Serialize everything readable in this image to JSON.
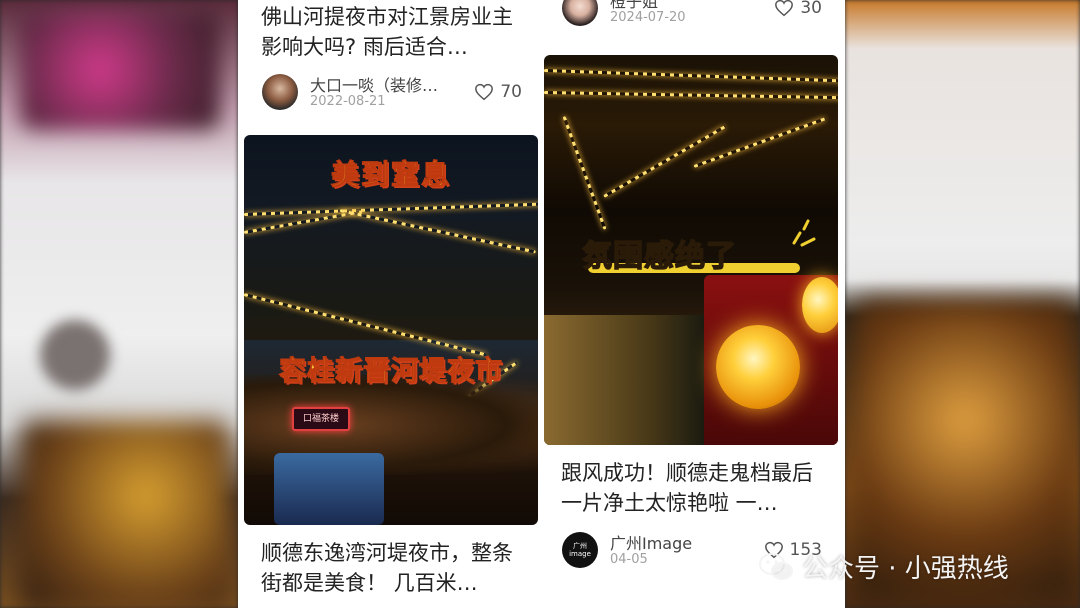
{
  "feed": {
    "left_column": {
      "post_1": {
        "title": "佛山河提夜市对江景房业主影响大吗? 雨后适合…",
        "author": "大口一啖（装修…",
        "date": "2022-08-21",
        "likes": "70"
      },
      "post_2": {
        "image_caption_top": "美到窒息",
        "image_caption_main": "容桂新晋河堤夜市",
        "image_sign": "口福茶楼",
        "title": "顺德东逸湾河堤夜市，整条街都是美食！ 几百米…"
      }
    },
    "right_column": {
      "post_1": {
        "author": "橙子姐",
        "date": "2024-07-20",
        "likes": "30"
      },
      "post_2": {
        "image_caption": "氛围感绝了",
        "title": "跟风成功！顺德走鬼档最后一片净土太惊艳啦 一…",
        "author": "广州Image",
        "avatar_text": "广州 image",
        "date": "04-05",
        "likes": "153"
      }
    }
  },
  "watermark": {
    "text": "公众号 · 小强热线",
    "icon": "wechat-icon"
  },
  "colors": {
    "caption_yellow": "#ffdd3a",
    "caption_outline": "#d0401a",
    "text_primary": "#222222",
    "text_secondary": "#a0a0a0"
  }
}
